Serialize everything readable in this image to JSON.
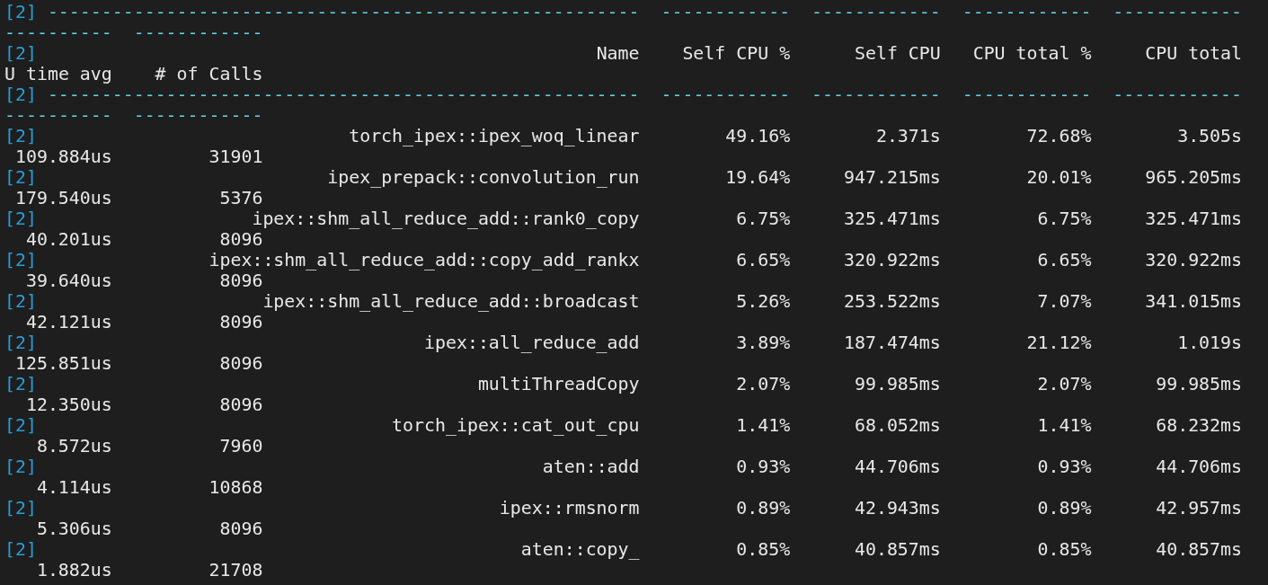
{
  "terminal": {
    "lines": [
      {
        "kind": "separator",
        "prefix": "[2]",
        "line1": [
          "-------------------------------------------------------",
          "------------",
          "------------",
          "------------",
          "------------"
        ],
        "line2": [
          "----------",
          "------------"
        ]
      },
      {
        "kind": "header",
        "prefix": "[2]",
        "line1": [
          "Name",
          "Self CPU %",
          "Self CPU",
          "CPU total %",
          "CPU total"
        ],
        "line2": [
          "U time avg",
          "# of Calls"
        ]
      },
      {
        "kind": "separator",
        "prefix": "[2]",
        "line1": [
          "-------------------------------------------------------",
          "------------",
          "------------",
          "------------",
          "------------"
        ],
        "line2": [
          "----------",
          "------------"
        ]
      },
      {
        "kind": "row",
        "prefix": "[2]",
        "line1": [
          "torch_ipex::ipex_woq_linear",
          "49.16%",
          "2.371s",
          "72.68%",
          "3.505s"
        ],
        "line2": [
          "109.884us",
          "31901"
        ]
      },
      {
        "kind": "row",
        "prefix": "[2]",
        "line1": [
          "ipex_prepack::convolution_run",
          "19.64%",
          "947.215ms",
          "20.01%",
          "965.205ms"
        ],
        "line2": [
          "179.540us",
          "5376"
        ]
      },
      {
        "kind": "row",
        "prefix": "[2]",
        "line1": [
          "ipex::shm_all_reduce_add::rank0_copy",
          "6.75%",
          "325.471ms",
          "6.75%",
          "325.471ms"
        ],
        "line2": [
          "40.201us",
          "8096"
        ]
      },
      {
        "kind": "row",
        "prefix": "[2]",
        "line1": [
          "ipex::shm_all_reduce_add::copy_add_rankx",
          "6.65%",
          "320.922ms",
          "6.65%",
          "320.922ms"
        ],
        "line2": [
          "39.640us",
          "8096"
        ]
      },
      {
        "kind": "row",
        "prefix": "[2]",
        "line1": [
          "ipex::shm_all_reduce_add::broadcast",
          "5.26%",
          "253.522ms",
          "7.07%",
          "341.015ms"
        ],
        "line2": [
          "42.121us",
          "8096"
        ]
      },
      {
        "kind": "row",
        "prefix": "[2]",
        "line1": [
          "ipex::all_reduce_add",
          "3.89%",
          "187.474ms",
          "21.12%",
          "1.019s"
        ],
        "line2": [
          "125.851us",
          "8096"
        ]
      },
      {
        "kind": "row",
        "prefix": "[2]",
        "line1": [
          "multiThreadCopy",
          "2.07%",
          "99.985ms",
          "2.07%",
          "99.985ms"
        ],
        "line2": [
          "12.350us",
          "8096"
        ]
      },
      {
        "kind": "row",
        "prefix": "[2]",
        "line1": [
          "torch_ipex::cat_out_cpu",
          "1.41%",
          "68.052ms",
          "1.41%",
          "68.232ms"
        ],
        "line2": [
          "8.572us",
          "7960"
        ]
      },
      {
        "kind": "row",
        "prefix": "[2]",
        "line1": [
          "aten::add",
          "0.93%",
          "44.706ms",
          "0.93%",
          "44.706ms"
        ],
        "line2": [
          "4.114us",
          "10868"
        ]
      },
      {
        "kind": "row",
        "prefix": "[2]",
        "line1": [
          "ipex::rmsnorm",
          "0.89%",
          "42.943ms",
          "0.89%",
          "42.957ms"
        ],
        "line2": [
          "5.306us",
          "8096"
        ]
      },
      {
        "kind": "row",
        "prefix": "[2]",
        "line1": [
          "aten::copy_",
          "0.85%",
          "40.857ms",
          "0.85%",
          "40.857ms"
        ],
        "line2": [
          "1.882us",
          "21708"
        ]
      }
    ]
  }
}
